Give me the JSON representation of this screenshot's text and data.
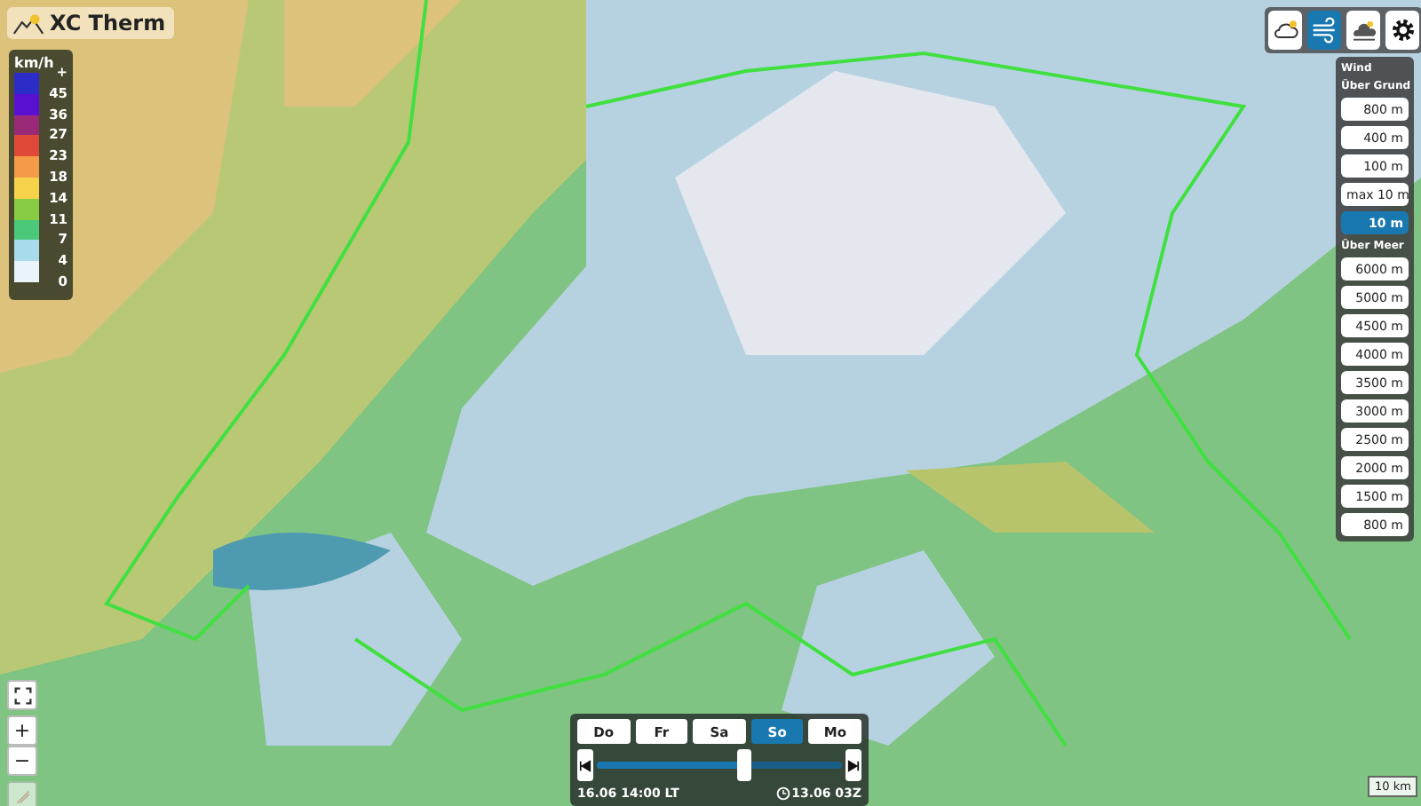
{
  "app": {
    "title": "XC Therm"
  },
  "legend": {
    "unit": "km/h",
    "items": [
      {
        "label": "+",
        "color": "#2c2cc8"
      },
      {
        "label": "45",
        "color": "#5a10d0"
      },
      {
        "label": "36",
        "color": "#9a2a78"
      },
      {
        "label": "27",
        "color": "#e04838"
      },
      {
        "label": "23",
        "color": "#f49a48"
      },
      {
        "label": "18",
        "color": "#f6d24a"
      },
      {
        "label": "14",
        "color": "#86cc44"
      },
      {
        "label": "11",
        "color": "#4cc87a"
      },
      {
        "label": "7",
        "color": "#a8dcec"
      },
      {
        "label": "4",
        "color": "#eaf2fa"
      }
    ],
    "last_label": "0"
  },
  "toolbar": [
    {
      "kind": "cloud",
      "selected": false
    },
    {
      "kind": "wind",
      "selected": true
    },
    {
      "kind": "weather",
      "selected": false
    },
    {
      "kind": "settings",
      "selected": false
    }
  ],
  "layers": {
    "title": "Wind",
    "groups": [
      {
        "title": "Über Grund",
        "items": [
          {
            "label": "800 m",
            "selected": false
          },
          {
            "label": "400 m",
            "selected": false
          },
          {
            "label": "100 m",
            "selected": false
          },
          {
            "label": "max 10 m",
            "selected": false
          },
          {
            "label": "10 m",
            "selected": true
          }
        ]
      },
      {
        "title": "Über Meer",
        "items": [
          {
            "label": "6000 m",
            "selected": false
          },
          {
            "label": "5000 m",
            "selected": false
          },
          {
            "label": "4500 m",
            "selected": false
          },
          {
            "label": "4000 m",
            "selected": false
          },
          {
            "label": "3500 m",
            "selected": false
          },
          {
            "label": "3000 m",
            "selected": false
          },
          {
            "label": "2500 m",
            "selected": false
          },
          {
            "label": "2000 m",
            "selected": false
          },
          {
            "label": "1500 m",
            "selected": false
          },
          {
            "label": "800 m",
            "selected": false
          }
        ]
      }
    ]
  },
  "map_controls": {
    "zoom_in": "+",
    "zoom_out": "−"
  },
  "timeline": {
    "days": [
      {
        "label": "Do",
        "selected": false
      },
      {
        "label": "Fr",
        "selected": false
      },
      {
        "label": "Sa",
        "selected": false
      },
      {
        "label": "So",
        "selected": true
      },
      {
        "label": "Mo",
        "selected": false
      }
    ],
    "level": 0.6,
    "valid_time": "16.06 14:00 LT",
    "run_time": "13.06 03Z"
  },
  "scale": "10 km"
}
